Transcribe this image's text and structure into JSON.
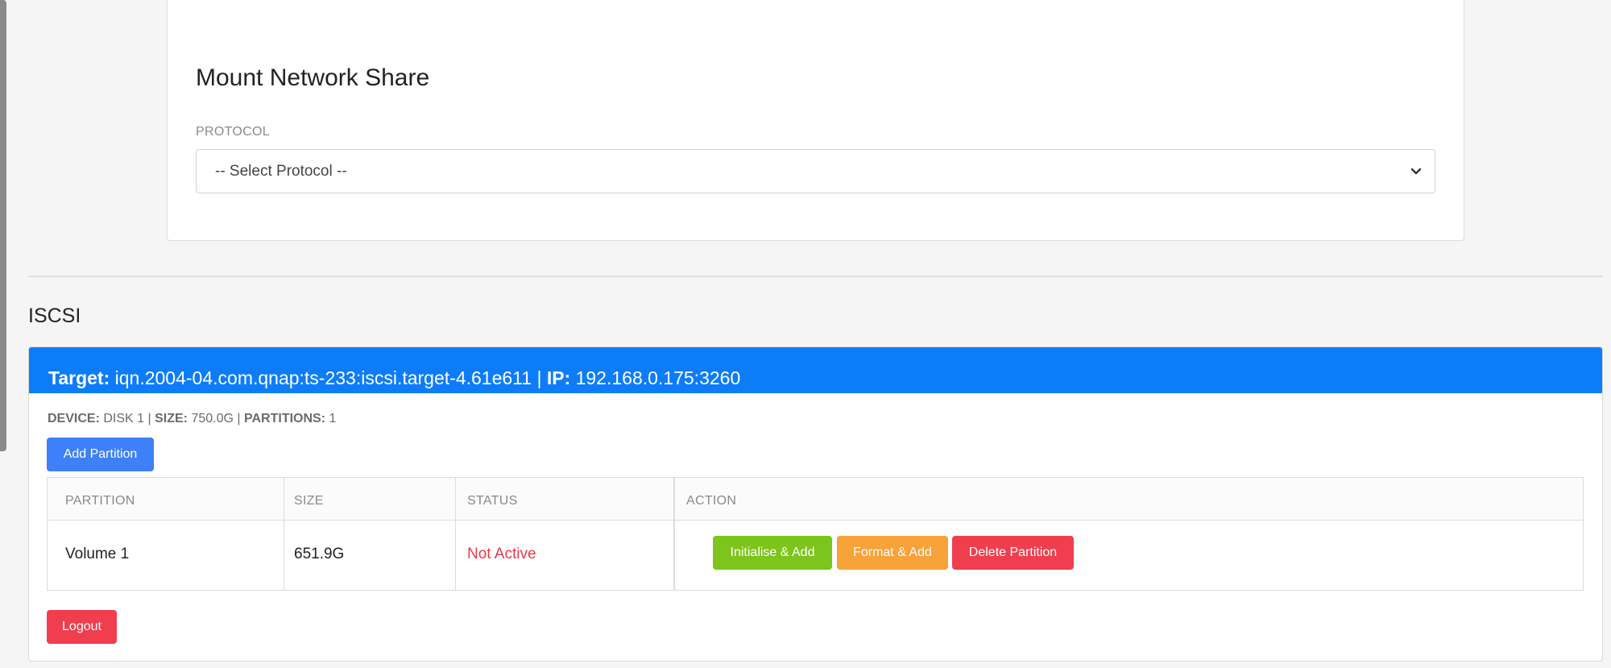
{
  "mount_share": {
    "title": "Mount Network Share",
    "protocol_label": "PROTOCOL",
    "protocol_selected": "-- Select Protocol --"
  },
  "iscsi": {
    "section_title": "ISCSI",
    "header": {
      "target_label": "Target:",
      "target_value": "iqn.2004-04.com.qnap:ts-233:iscsi.target-4.61e611",
      "separator": "|",
      "ip_label": "IP:",
      "ip_value": "192.168.0.175:3260"
    },
    "device": {
      "device_label": "DEVICE:",
      "device_value": "DISK 1",
      "size_label": "SIZE:",
      "size_value": "750.0G",
      "partitions_label": "PARTITIONS:",
      "partitions_value": "1",
      "sep": "|"
    },
    "add_partition_label": "Add Partition",
    "table": {
      "headers": [
        "PARTITION",
        "SIZE",
        "STATUS",
        "ACTION"
      ],
      "rows": [
        {
          "partition": "Volume 1",
          "size": "651.9G",
          "status": "Not Active"
        }
      ]
    },
    "actions": {
      "initialise": "Initialise & Add",
      "format": "Format & Add",
      "delete": "Delete Partition"
    },
    "logout_label": "Logout"
  },
  "icons": {
    "select_arrow": "chevron-down-icon"
  },
  "colors": {
    "header_blue": "#0d7cf9",
    "add_blue": "#3e80f7",
    "init_green": "#7dc41c",
    "format_orange": "#f8a23a",
    "danger_red": "#f03e4f",
    "status_red": "#ee3847"
  }
}
